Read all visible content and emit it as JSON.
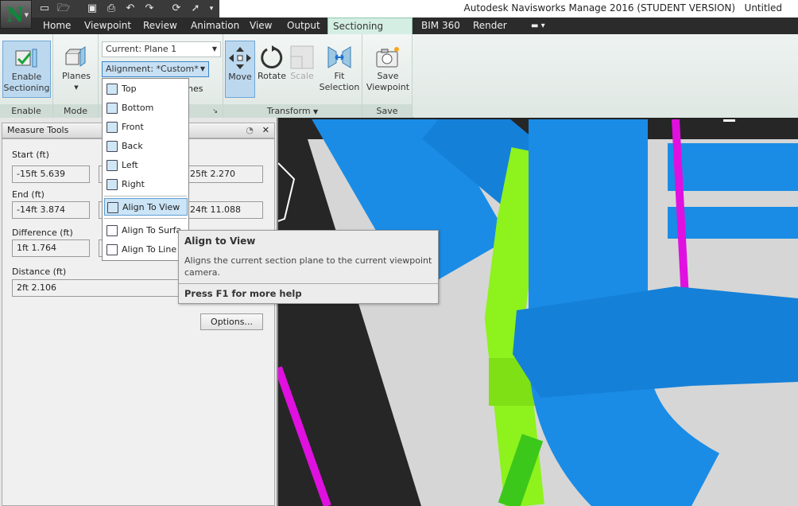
{
  "app": {
    "title": "Autodesk Navisworks Manage 2016 (STUDENT VERSION)",
    "document": "Untitled",
    "logo": "N"
  },
  "qat": {
    "icons": [
      "new-icon",
      "open-icon",
      "save-icon",
      "print-icon",
      "undo-icon",
      "redo-icon",
      "refresh-icon",
      "select-icon",
      "customize-icon"
    ]
  },
  "tabs": [
    {
      "label": "Home"
    },
    {
      "label": "Viewpoint"
    },
    {
      "label": "Review"
    },
    {
      "label": "Animation"
    },
    {
      "label": "View"
    },
    {
      "label": "Output"
    },
    {
      "label": "Sectioning Tools",
      "active": true
    },
    {
      "label": "BIM 360"
    },
    {
      "label": "Render"
    }
  ],
  "ribbon": {
    "enable": {
      "label": "Enable",
      "button": "Enable\nSectioning"
    },
    "mode": {
      "label": "Mode",
      "button": "Planes"
    },
    "planes": {
      "current": "Current: Plane 1",
      "alignment": "Alignment: *Custom*",
      "hidden_text": "nes"
    },
    "transform": {
      "label": "Transform",
      "move": "Move",
      "rotate": "Rotate",
      "scale": "Scale",
      "fit": "Fit\nSelection"
    },
    "save": {
      "label": "Save",
      "button": "Save\nViewpoint"
    }
  },
  "alignment_menu": {
    "items": [
      "Top",
      "Bottom",
      "Front",
      "Back",
      "Left",
      "Right",
      "Align To View",
      "Align To Surface",
      "Align To Line"
    ],
    "highlighted": "Align To View"
  },
  "tooltip": {
    "title": "Align to View",
    "description": "Aligns the current section plane to the current viewpoint camera.",
    "help": "Press F1 for more help"
  },
  "measure_tools": {
    "title": "Measure Tools",
    "start": {
      "label": "Start (ft)",
      "x": "-15ft 5.639",
      "z": "25ft 2.270"
    },
    "end": {
      "label": "End (ft)",
      "x": "-14ft 3.874",
      "z": "24ft 11.088"
    },
    "difference": {
      "label": "Difference (ft)",
      "x": "1ft 1.764"
    },
    "distance": {
      "label": "Distance (ft)",
      "value": "2ft 2.106"
    },
    "options": "Options..."
  },
  "colors": {
    "pipe_blue": "#1a8ce6",
    "pipe_green": "#8ef21c",
    "pipe_magenta": "#e010e0",
    "active_tab": "#d5eee4"
  }
}
